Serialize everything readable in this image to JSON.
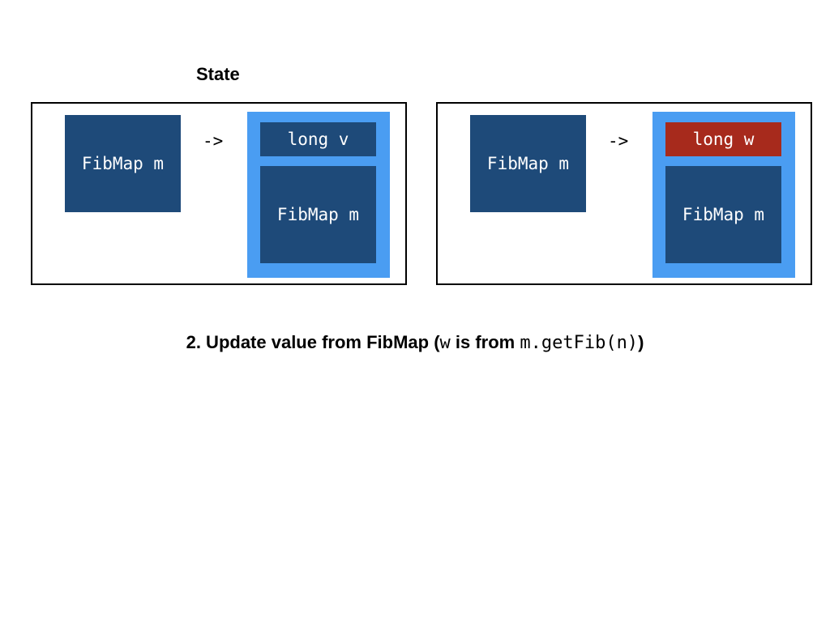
{
  "heading": "State",
  "panels": [
    {
      "key_label": "FibMap m",
      "arrow": "->",
      "value_label": "long v",
      "inner_map_label": "FibMap m"
    },
    {
      "key_label": "FibMap m",
      "arrow": "->",
      "value_label": "long w",
      "inner_map_label": "FibMap m"
    }
  ],
  "caption": {
    "prefix": "2. Update value from FibMap (",
    "code1": "w",
    "middle": " is from ",
    "code2": "m.getFib(n)",
    "suffix": ")"
  },
  "colors": {
    "box": "#1e4a79",
    "frame": "#4a9df2",
    "highlight": "#a72a1c"
  }
}
